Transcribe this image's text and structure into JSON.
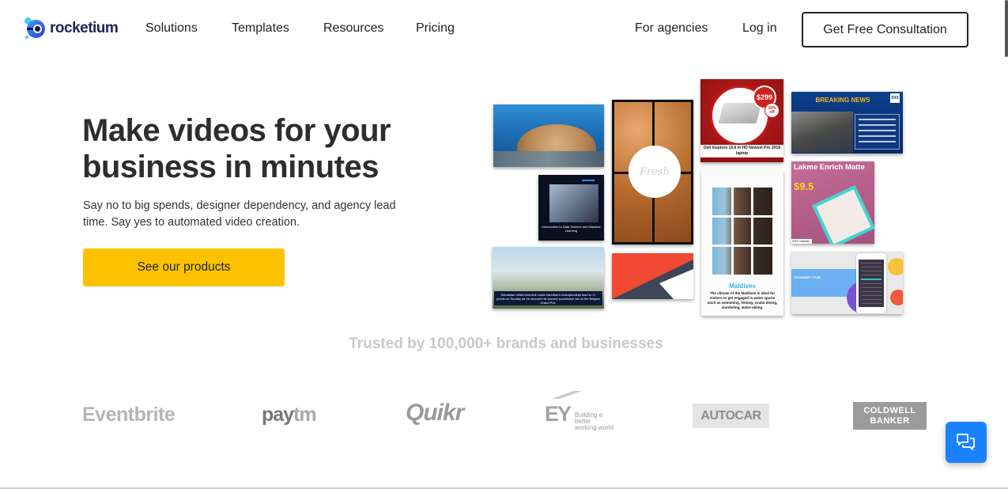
{
  "nav": {
    "brand": "rocketium",
    "links": [
      "Solutions",
      "Templates",
      "Resources",
      "Pricing"
    ],
    "right_links": [
      "For agencies",
      "Log in"
    ],
    "cta": "Get Free Consultation"
  },
  "hero": {
    "title_line1": "Make videos for your",
    "title_line2": "business in minutes",
    "subtitle": "Say no to big spends, designer dependency, and agency lead time. Say yes to automated video creation.",
    "cta": "See our products"
  },
  "collage": {
    "bread_text": "Fresh",
    "dell_price": "$299",
    "dell_discount": "15% off",
    "dell_caption": "Dell Inspiron 15.6 in HD Newest Pro 2018 laptop",
    "news_headline": "BREAKING NEWS",
    "news_logo": "DH",
    "tech_caption": "Introduction to Data Science and Machine Learning",
    "maldives_title": "Maldives",
    "maldives_desc": "The climate of the Maldives is ideal for visitors to get engaged in water sports such as swimming, fishing, scuba diving, snorkeling, water-skiing.",
    "lakme_name": "Lakme Enrich Matte",
    "lakme_price": "$9.5",
    "lakme_tag": "KKS natural",
    "field_caption": "Sebastian Vettel trimmed Lewis Hamilton's championship lead to 17 points on Sunday as he secured his second successive win at the Belgian Grand Prix.",
    "phone_text": "ORGANIZE YOUR"
  },
  "trusted": {
    "heading": "Trusted by 100,000+ brands and businesses",
    "brands": {
      "eventbrite": "Eventbrite",
      "paytm_pay": "pay",
      "paytm_tm": "tm",
      "quikr": "Quikr",
      "ey": "EY",
      "ey_tag": "Building a better working world",
      "autocar": "AUTOCAR",
      "coldwell_1": "COLDWELL",
      "coldwell_2": "BANKER"
    }
  },
  "chat": {
    "icon": "chat-bubbles-icon"
  },
  "colors": {
    "accent": "#fcc200",
    "chat": "#1a82ff",
    "text": "#2d2d2d"
  }
}
